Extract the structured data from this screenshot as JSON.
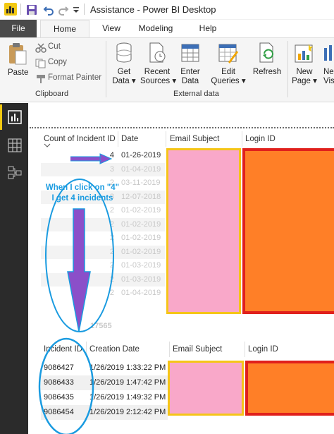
{
  "window": {
    "title": "Assistance - Power BI Desktop"
  },
  "tabs": [
    {
      "label": "File"
    },
    {
      "label": "Home"
    },
    {
      "label": "View"
    },
    {
      "label": "Modeling"
    },
    {
      "label": "Help"
    }
  ],
  "ribbon": {
    "clipboard": {
      "paste": "Paste",
      "cut": "Cut",
      "copy": "Copy",
      "format_painter": "Format Painter",
      "group_label": "Clipboard"
    },
    "external_data": {
      "get_data_1": "Get",
      "get_data_2": "Data",
      "recent_sources_1": "Recent",
      "recent_sources_2": "Sources",
      "enter_data_1": "Enter",
      "enter_data_2": "Data",
      "edit_queries_1": "Edit",
      "edit_queries_2": "Queries",
      "refresh": "Refresh",
      "group_label": "External data"
    },
    "insert": {
      "new_page_1": "New",
      "new_page_2": "Page",
      "new_visual_1": "Ne",
      "new_visual_2": "Vis"
    }
  },
  "table1": {
    "headers": [
      "Count of Incident ID",
      "Date",
      "Email Subject",
      "Login ID"
    ],
    "rows": [
      {
        "count": "4",
        "date": "01-26-2019"
      },
      {
        "count": "3",
        "date": "01-04-2019"
      },
      {
        "count": "2",
        "date": "03-11-2019"
      },
      {
        "count": "3",
        "date": "12-07-2018"
      },
      {
        "count": "2",
        "date": "01-02-2019"
      },
      {
        "count": "2",
        "date": "01-02-2019"
      },
      {
        "count": "2",
        "date": "01-02-2019"
      },
      {
        "count": "2",
        "date": "01-02-2019"
      },
      {
        "count": "2",
        "date": "01-03-2019"
      },
      {
        "count": "2",
        "date": "01-03-2019"
      },
      {
        "count": "2",
        "date": "01-04-2019"
      }
    ],
    "total": "17565"
  },
  "table2": {
    "headers": [
      "Incident ID",
      "Creation Date",
      "Email Subject",
      "Login ID"
    ],
    "rows": [
      {
        "id": "9086427",
        "created": "1/26/2019 1:33:22 PM"
      },
      {
        "id": "9086433",
        "created": "1/26/2019 1:47:42 PM"
      },
      {
        "id": "9086435",
        "created": "1/26/2019 1:49:32 PM"
      },
      {
        "id": "9086454",
        "created": "1/26/2019 2:12:42 PM"
      }
    ]
  },
  "annotation": {
    "line1": "When I click on \"4\"",
    "line2": "I get 4 incidents"
  },
  "colors": {
    "accent_yellow": "#f2c811",
    "redact_pink": "#f9a8c9",
    "redact_orange": "#ff7f27",
    "border_gold": "#f5c518",
    "border_red": "#e0201c",
    "annotation_blue": "#1a9be0",
    "arrow_purple": "#8b4fc9"
  }
}
